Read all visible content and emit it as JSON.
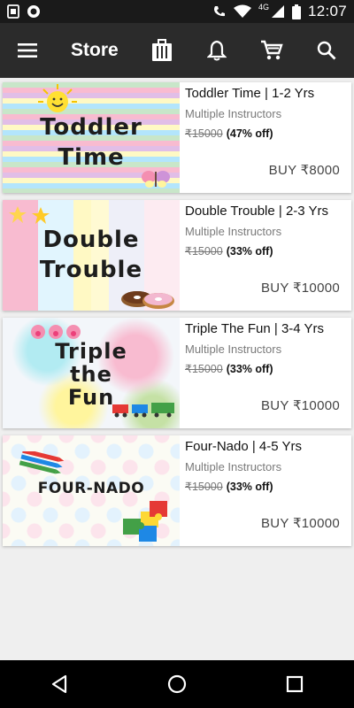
{
  "status_bar": {
    "time": "12:07",
    "network": "4G"
  },
  "app_bar": {
    "title": "Store",
    "icons": [
      "menu-icon",
      "catalog-icon",
      "bell-icon",
      "cart-icon",
      "search-icon"
    ]
  },
  "courses": [
    {
      "title": "Toddler Time | 1-2 Yrs",
      "instructor": "Multiple Instructors",
      "original_price": "₹15000",
      "discount": "(47% off)",
      "buy_label": "BUY ₹8000",
      "thumb_line1": "Toddler",
      "thumb_line2": "Time"
    },
    {
      "title": "Double Trouble | 2-3 Yrs",
      "instructor": "Multiple Instructors",
      "original_price": "₹15000",
      "discount": "(33% off)",
      "buy_label": "BUY ₹10000",
      "thumb_line1": "Double",
      "thumb_line2": "Trouble"
    },
    {
      "title": "Triple The Fun | 3-4 Yrs",
      "instructor": "Multiple Instructors",
      "original_price": "₹15000",
      "discount": "(33% off)",
      "buy_label": "BUY ₹10000",
      "thumb_line1": "Triple",
      "thumb_line2": "the",
      "thumb_line3": "Fun"
    },
    {
      "title": "Four-Nado | 4-5 Yrs",
      "instructor": "Multiple Instructors",
      "original_price": "₹15000",
      "discount": "(33% off)",
      "buy_label": "BUY ₹10000",
      "thumb_line1": "FOUR-NADO"
    }
  ],
  "colors": {
    "app_bar": "#2b2b2b",
    "status_bar": "#1a1a1a",
    "background": "#efefef"
  }
}
